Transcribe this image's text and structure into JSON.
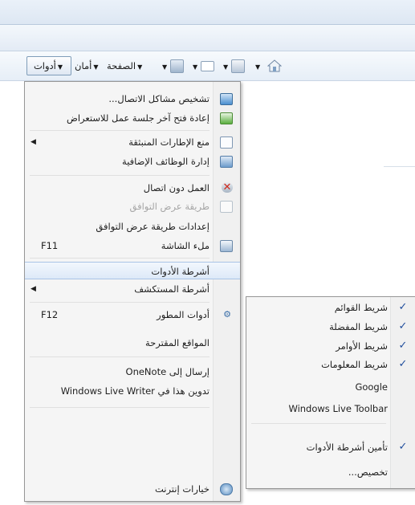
{
  "commandbar": {
    "tools": "أدوات",
    "safety": "أمان",
    "page": "الصفحة",
    "icons": [
      "home-icon",
      "feeds-icon",
      "mail-icon",
      "print-icon"
    ]
  },
  "menu": {
    "items": [
      {
        "label": "تشخيص مشاكل الاتصال...",
        "icon": "diagnose-connection-icon"
      },
      {
        "label": "إعادة فتح آخر جلسة عمل للاستعراض",
        "icon": "reopen-session-icon"
      },
      {
        "label": "منع الإطارات المنبثقة",
        "icon": "popup-blocker-icon"
      },
      {
        "label": "إدارة الوظائف الإضافية",
        "icon": "manage-addons-icon"
      },
      {
        "label": "العمل دون اتصال",
        "icon": "work-offline-icon"
      },
      {
        "label": "طريقة عرض التوافق",
        "icon": "compatibility-view-icon"
      },
      {
        "label": "إعدادات طريقة عرض التوافق"
      },
      {
        "label": "ملء الشاشة",
        "shortcut": "F11",
        "icon": "fullscreen-icon"
      },
      {
        "label": "أشرطة الأدوات"
      },
      {
        "label": "أشرطة المستكشف"
      },
      {
        "label": "أدوات المطور",
        "shortcut": "F12",
        "icon": "developer-tools-icon"
      },
      {
        "label": "المواقع المقترحة"
      },
      {
        "label": "إرسال إلى OneNote"
      },
      {
        "label": "تدوين هذا في Windows Live Writer"
      },
      {
        "label": "خيارات إنترنت",
        "icon": "internet-options-icon"
      }
    ]
  },
  "submenu": {
    "items": [
      {
        "label": "شريط القوائم",
        "checked": "✓"
      },
      {
        "label": "شريط المفضلة",
        "checked": "✓"
      },
      {
        "label": "شريط الأوامر",
        "checked": "✓"
      },
      {
        "label": "شريط المعلومات",
        "checked": "✓"
      },
      {
        "label": "Google",
        "checked": ""
      },
      {
        "label": "Windows Live Toolbar",
        "checked": ""
      },
      {
        "label": "تأمين أشرطة الأدوات",
        "checked": "✓"
      },
      {
        "label": "تخصيص...",
        "checked": ""
      }
    ]
  },
  "colors": {
    "menu_bg": "#f5f5f5",
    "highlight": "#dde9f8",
    "check": "#1f4d9c",
    "disabled_text": "#a6a6a6"
  }
}
